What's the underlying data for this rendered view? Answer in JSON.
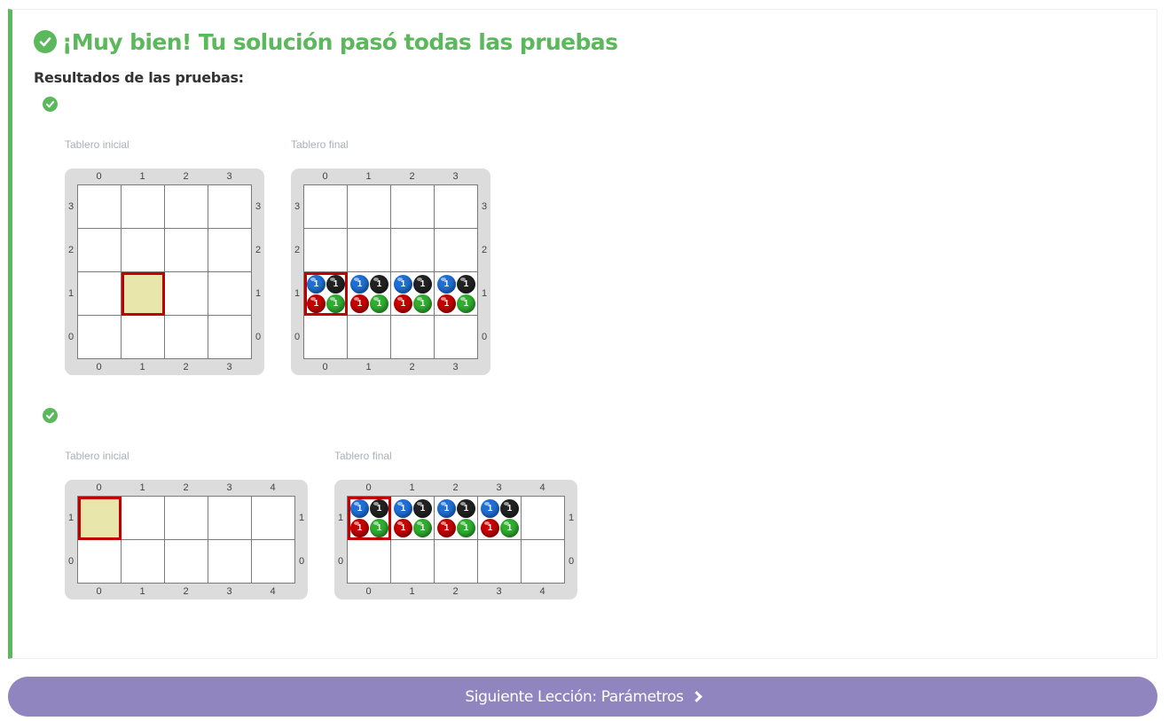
{
  "result": {
    "title": "¡Muy bien! Tu solución pasó todas las pruebas",
    "results_label": "Resultados de las pruebas:",
    "status": "passed",
    "accent_color": "#5cb85c"
  },
  "ball_colors": {
    "blue": "#1f6fd6",
    "black": "#222222",
    "red": "#c40000",
    "green": "#2fae2f"
  },
  "tests": [
    {
      "status": "passed",
      "initial": {
        "caption": "Tablero inicial",
        "cols": [
          "0",
          "1",
          "2",
          "3"
        ],
        "rows": [
          "3",
          "2",
          "1",
          "0"
        ],
        "head": {
          "col": 1,
          "row": 1
        },
        "stones": []
      },
      "final": {
        "caption": "Tablero final",
        "cols": [
          "0",
          "1",
          "2",
          "3"
        ],
        "rows": [
          "3",
          "2",
          "1",
          "0"
        ],
        "head": {
          "col": 0,
          "row": 1
        },
        "stones": [
          {
            "col": 0,
            "row": 1,
            "blue": "1",
            "black": "1",
            "red": "1",
            "green": "1"
          },
          {
            "col": 1,
            "row": 1,
            "blue": "1",
            "black": "1",
            "red": "1",
            "green": "1"
          },
          {
            "col": 2,
            "row": 1,
            "blue": "1",
            "black": "1",
            "red": "1",
            "green": "1"
          },
          {
            "col": 3,
            "row": 1,
            "blue": "1",
            "black": "1",
            "red": "1",
            "green": "1"
          }
        ]
      }
    },
    {
      "status": "passed",
      "initial": {
        "caption": "Tablero inicial",
        "cols": [
          "0",
          "1",
          "2",
          "3",
          "4"
        ],
        "rows": [
          "1",
          "0"
        ],
        "head": {
          "col": 0,
          "row": 1
        },
        "stones": []
      },
      "final": {
        "caption": "Tablero final",
        "cols": [
          "0",
          "1",
          "2",
          "3",
          "4"
        ],
        "rows": [
          "1",
          "0"
        ],
        "head": {
          "col": 0,
          "row": 1
        },
        "stones": [
          {
            "col": 0,
            "row": 1,
            "blue": "1",
            "black": "1",
            "red": "1",
            "green": "1"
          },
          {
            "col": 1,
            "row": 1,
            "blue": "1",
            "black": "1",
            "red": "1",
            "green": "1"
          },
          {
            "col": 2,
            "row": 1,
            "blue": "1",
            "black": "1",
            "red": "1",
            "green": "1"
          },
          {
            "col": 3,
            "row": 1,
            "blue": "1",
            "black": "1",
            "red": "1",
            "green": "1"
          }
        ]
      }
    }
  ],
  "next_button": {
    "label": "Siguiente Lección: Parámetros",
    "icon": "chevron-right-icon"
  }
}
